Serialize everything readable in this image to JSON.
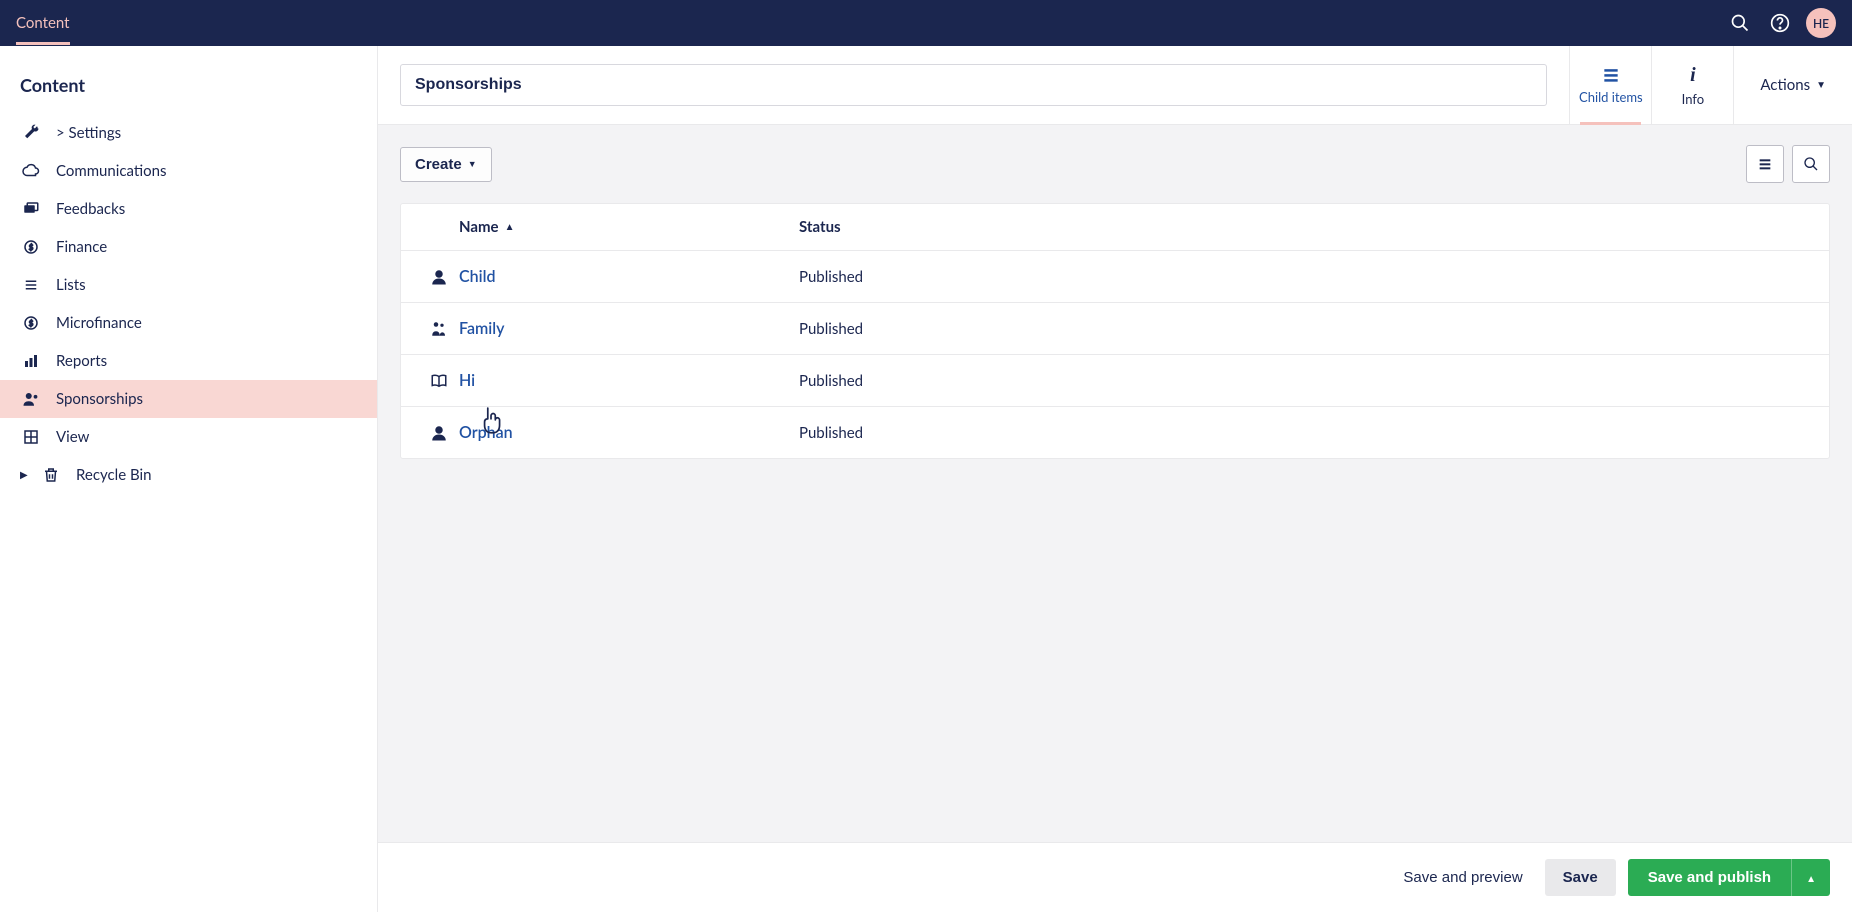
{
  "topbar": {
    "section": "Content",
    "avatar_initials": "HE"
  },
  "sidebar": {
    "heading": "Content",
    "items": [
      {
        "label": "> Settings",
        "icon": "wrench"
      },
      {
        "label": "Communications",
        "icon": "cloud"
      },
      {
        "label": "Feedbacks",
        "icon": "folders"
      },
      {
        "label": "Finance",
        "icon": "coin"
      },
      {
        "label": "Lists",
        "icon": "list-lines"
      },
      {
        "label": "Microfinance",
        "icon": "coin"
      },
      {
        "label": "Reports",
        "icon": "chart"
      },
      {
        "label": "Sponsorships",
        "icon": "users",
        "active": true
      },
      {
        "label": "View",
        "icon": "grid"
      },
      {
        "label": "Recycle Bin",
        "icon": "trash",
        "caret": true
      }
    ]
  },
  "header": {
    "title_value": "Sponsorships",
    "tabs": {
      "child_items": "Child items",
      "info": "Info"
    },
    "actions_label": "Actions"
  },
  "toolbar": {
    "create_label": "Create"
  },
  "table": {
    "columns": {
      "name": "Name",
      "status": "Status"
    },
    "rows": [
      {
        "name": "Child",
        "icon": "person",
        "status": "Published"
      },
      {
        "name": "Family",
        "icon": "family",
        "status": "Published"
      },
      {
        "name": "Hi",
        "icon": "book",
        "status": "Published"
      },
      {
        "name": "Orphan",
        "icon": "person",
        "status": "Published"
      }
    ]
  },
  "footer": {
    "preview_label": "Save and preview",
    "save_label": "Save",
    "publish_label": "Save and publish"
  }
}
